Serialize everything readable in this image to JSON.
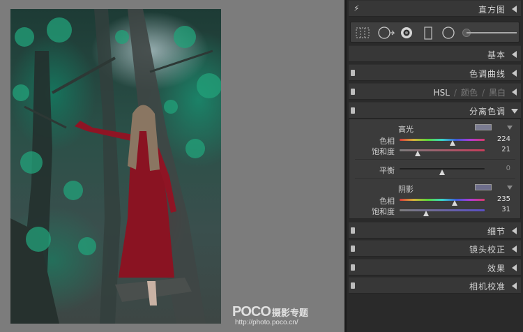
{
  "panel": {
    "histogram_label": "直方图",
    "basic_label": "基本",
    "tone_curve_label": "色调曲线",
    "hsl_tabs": [
      "HSL",
      "颜色",
      "黑白"
    ],
    "split_toning_label": "分离色调",
    "detail_label": "细节",
    "lens_label": "镜头校正",
    "effects_label": "效果",
    "camera_calibration_label": "相机校准"
  },
  "split_toning": {
    "highlights": {
      "title": "高光",
      "swatch_color": "#7b7c92",
      "hue_label": "色相",
      "hue_value": "224",
      "hue_fraction": 0.62,
      "sat_label": "饱和度",
      "sat_value": "21",
      "sat_fraction": 0.21
    },
    "balance": {
      "label": "平衡",
      "value": "0",
      "fraction": 0.5
    },
    "shadows": {
      "title": "阴影",
      "swatch_color": "#6e6e8c",
      "hue_label": "色相",
      "hue_value": "235",
      "hue_fraction": 0.65,
      "sat_label": "饱和度",
      "sat_value": "31",
      "sat_fraction": 0.31
    }
  },
  "watermark": {
    "brand": "POCO",
    "title": "摄影专题",
    "url": "http://photo.poco.cn/"
  },
  "icons": [
    "lightning-icon",
    "grid-crop-icon",
    "spot-removal-icon",
    "redeye-icon",
    "graduated-filter-icon",
    "radial-filter-icon",
    "brush-icon"
  ]
}
